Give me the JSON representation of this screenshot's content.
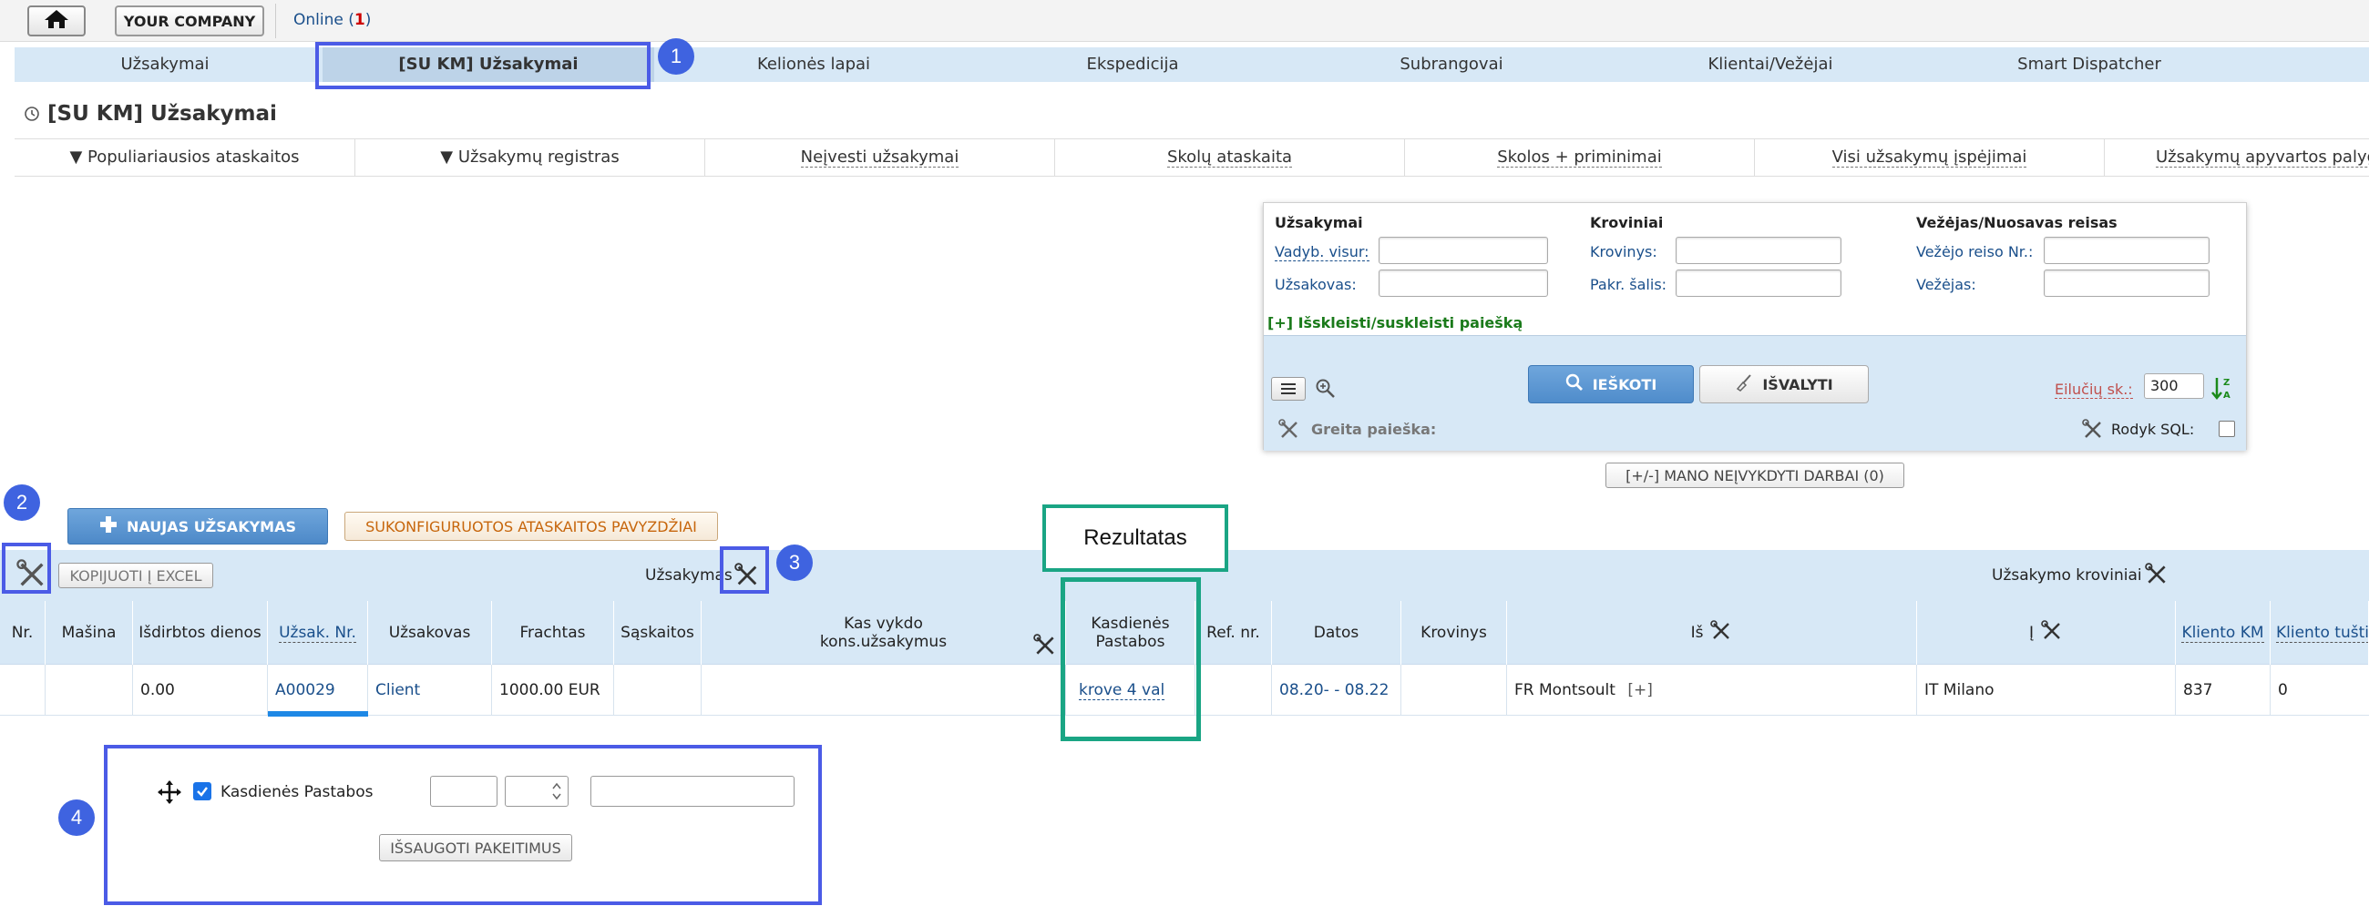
{
  "topbar": {
    "company": "YOUR COMPANY",
    "online_label": "Online (",
    "online_count": "1",
    "online_close": ")"
  },
  "main_tabs": [
    "Užsakymai",
    "[SU KM] Užsakymai",
    "Kelionės lapai",
    "Ekspedicija",
    "Subrangovai",
    "Klientai/Vežėjai",
    "Smart Dispatcher"
  ],
  "page_title": "[SU KM] Užsakymai",
  "report_tabs": [
    "▼ Populiariausios ataskaitos",
    "▼ Užsakymų registras",
    "Neįvesti užsakymai",
    "Skolų ataskaita",
    "Skolos + priminimai",
    "Visi užsakymų įspėjimai",
    "Užsakymų apyvartos palyginimas"
  ],
  "search": {
    "orders_heading": "Užsakymai",
    "manager_label": "Vadyb. visur:",
    "customer_label": "Užsakovas:",
    "cargo_heading": "Kroviniai",
    "cargo_label": "Krovinys:",
    "load_country_label": "Pakr. šalis:",
    "carrier_heading": "Vežėjas/Nuosavas reisas",
    "carrier_trip_label": "Vežėjo reiso Nr.:",
    "carrier_label": "Vežėjas:",
    "expand_label": "[+] Išskleisti/suskleisti paiešką",
    "search_button": "IEŠKOTI",
    "clear_button": "IŠVALYTI",
    "rows_label": "Eilučių sk.:",
    "rows_value": "300",
    "quick_search_label": "Greita paieška:",
    "sql_label": "Rodyk SQL:"
  },
  "mano_button": "[+/-] MANO NEĮVYKDYTI DARBAI (0)",
  "new_order_button": "NAUJAS UŽSAKYMAS",
  "examples_button": "SUKONFIGURUOTOS ATASKAITOS PAVYZDŽIAI",
  "toolbar": {
    "copy_excel": "KOPIJUOTI Į EXCEL",
    "group_orders": "Užsakymas",
    "group_cargo": "Užsakymo kroviniai"
  },
  "table": {
    "headers": [
      "Nr.",
      "Mašina",
      "Išdirbtos dienos",
      "Užsak. Nr.",
      "Užsakovas",
      "Frachtas",
      "Sąskaitos",
      "Kas vykdo",
      "kons.užsakymus",
      "Kasdienės",
      "Pastabos",
      "Ref. nr.",
      "Datos",
      "Krovinys",
      "Iš",
      "Į",
      "Kliento KM",
      "Kliento tušti"
    ],
    "row": {
      "days": "0.00",
      "order_no": "A00029",
      "customer": "Client",
      "freight": "1000.00 EUR",
      "daily_notes": "krove 4 val",
      "dates": "08.20- - 08.22",
      "from": "FR Montsoult",
      "from_more": "[+]",
      "to": "IT Milano",
      "client_km": "837",
      "client_empty": "0"
    }
  },
  "config": {
    "field_label": "Kasdienės Pastabos",
    "save_button": "IŠSAUGOTI PAKEITIMUS"
  },
  "annotations": {
    "badge1": "1",
    "badge2": "2",
    "badge3": "3",
    "badge4": "4",
    "result_label": "Rezultatas"
  },
  "colors": {
    "annotation_blue": "#4b5be6",
    "annotation_green": "#1aa584",
    "header_bg": "#d7e8f6",
    "primary_button": "#4f8ccb"
  }
}
